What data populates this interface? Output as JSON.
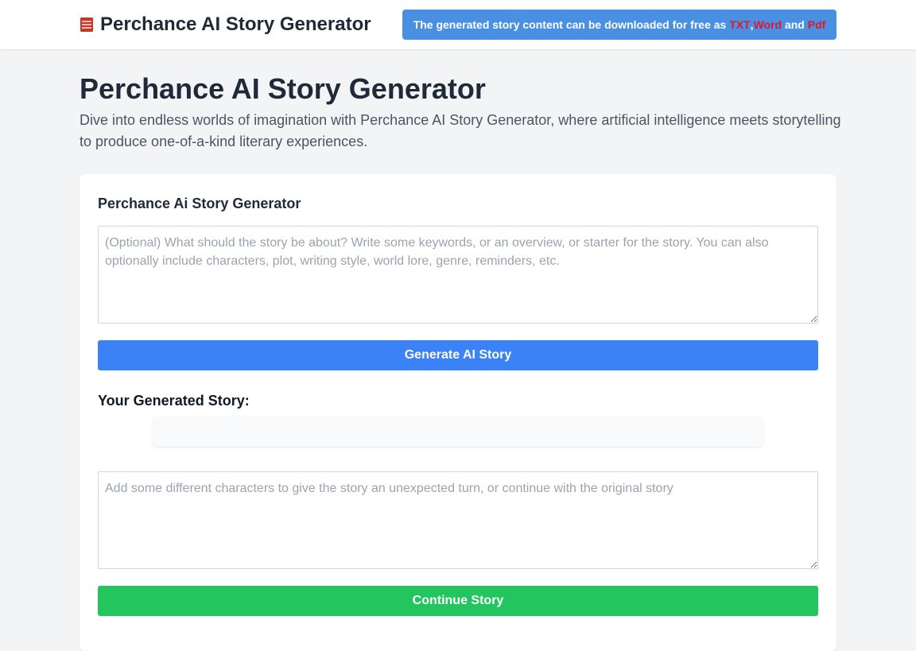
{
  "header": {
    "brand_icon": "book-icon",
    "brand_name": "Perchance AI Story Generator",
    "banner": {
      "prefix": "The generated story content can be downloaded for free as ",
      "format_txt": "TXT",
      "separator": ",",
      "format_word": "Word",
      "conjunction": " and ",
      "format_pdf": "Pdf",
      "background_color": "#4a90e2",
      "highlight_color": "#e0182d"
    }
  },
  "hero": {
    "title": "Perchance AI Story Generator",
    "description": "Dive into endless worlds of imagination with Perchance AI Story Generator, where artificial intelligence meets storytelling to produce one-of-a-kind literary experiences."
  },
  "generator": {
    "title": "Perchance Ai Story Generator",
    "prompt_placeholder": "(Optional) What should the story be about? Write some keywords, or an overview, or starter for the story. You can also optionally include characters, plot, writing style, world lore, genre, reminders, etc.",
    "prompt_value": "",
    "generate_label": "Generate AI Story",
    "generate_color": "#3b82f6",
    "story_heading": "Your Generated Story:",
    "story_output": "",
    "continue_placeholder": "Add some different characters to give the story an unexpected turn, or continue with the original story",
    "continue_value": "",
    "continue_label": "Continue Story",
    "continue_color": "#22c55e"
  }
}
